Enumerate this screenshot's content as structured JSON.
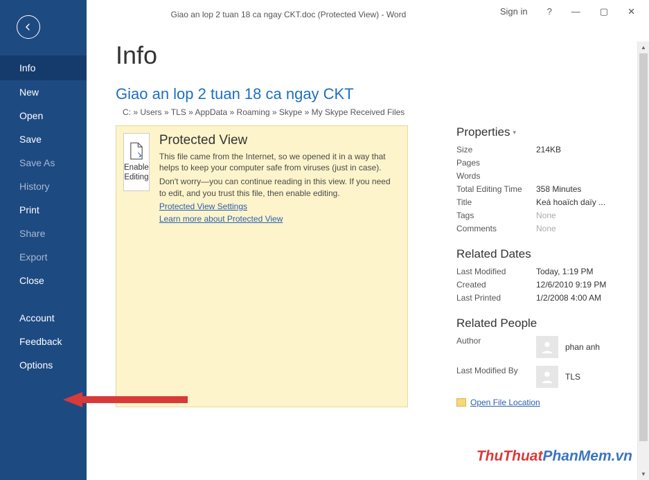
{
  "titlebar": {
    "title": "Giao an lop 2 tuan 18 ca ngay CKT.doc (Protected View)  -  Word",
    "signin": "Sign in",
    "help": "?",
    "min": "—",
    "max": "▢",
    "close": "✕"
  },
  "sidebar": {
    "items": [
      {
        "label": "Info",
        "selected": true,
        "dim": false
      },
      {
        "label": "New",
        "selected": false,
        "dim": false
      },
      {
        "label": "Open",
        "selected": false,
        "dim": false
      },
      {
        "label": "Save",
        "selected": false,
        "dim": false
      },
      {
        "label": "Save As",
        "selected": false,
        "dim": true
      },
      {
        "label": "History",
        "selected": false,
        "dim": true
      },
      {
        "label": "Print",
        "selected": false,
        "dim": false
      },
      {
        "label": "Share",
        "selected": false,
        "dim": true
      },
      {
        "label": "Export",
        "selected": false,
        "dim": true
      },
      {
        "label": "Close",
        "selected": false,
        "dim": false
      }
    ],
    "bottom": [
      {
        "label": "Account"
      },
      {
        "label": "Feedback"
      },
      {
        "label": "Options"
      }
    ]
  },
  "main": {
    "heading": "Info",
    "doc_title": "Giao an lop 2 tuan 18 ca ngay CKT",
    "doc_path": "C: » Users » TLS » AppData » Roaming » Skype » My Skype Received Files",
    "protected_view": {
      "btn_line1": "Enable",
      "btn_line2": "Editing",
      "title": "Protected View",
      "p1": "This file came from the Internet, so we opened it in a way that helps to keep your computer safe from viruses (just in case).",
      "p2": "Don't worry—you can continue reading in this view. If you need to edit, and you trust this file, then enable editing.",
      "link1": "Protected View Settings",
      "link2": "Learn more about Protected View"
    },
    "properties": {
      "heading": "Properties",
      "rows": [
        {
          "label": "Size",
          "value": "214KB"
        },
        {
          "label": "Pages",
          "value": ""
        },
        {
          "label": "Words",
          "value": ""
        },
        {
          "label": "Total Editing Time",
          "value": "358 Minutes"
        },
        {
          "label": "Title",
          "value": "Keá hoaïch daïy ..."
        },
        {
          "label": "Tags",
          "value": "None",
          "dim": true
        },
        {
          "label": "Comments",
          "value": "None",
          "dim": true
        }
      ]
    },
    "related_dates": {
      "heading": "Related Dates",
      "rows": [
        {
          "label": "Last Modified",
          "value": "Today, 1:19 PM"
        },
        {
          "label": "Created",
          "value": "12/6/2010 9:19 PM"
        },
        {
          "label": "Last Printed",
          "value": "1/2/2008 4:00 AM"
        }
      ]
    },
    "related_people": {
      "heading": "Related People",
      "author_label": "Author",
      "author_name": "phan anh",
      "modified_by_label": "Last Modified By",
      "modified_by_name": "TLS"
    },
    "open_location": "Open File Location"
  },
  "watermark": {
    "a": "ThuThuat",
    "b": "PhanMem",
    "c": ".vn"
  }
}
